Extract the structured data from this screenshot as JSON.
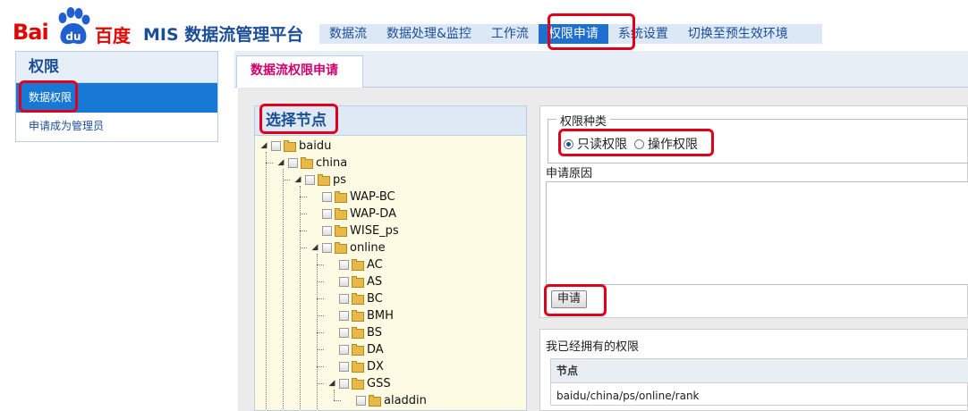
{
  "header": {
    "logo_left": "Bai",
    "logo_mid": "du",
    "logo_right": "百度",
    "app_title": "MIS 数据流管理平台",
    "nav": [
      "数据流",
      "数据处理&监控",
      "工作流",
      "权限申请",
      "系统设置",
      "切换至预生效环境"
    ],
    "active_nav": "权限申请"
  },
  "sidebar": {
    "title": "权限",
    "items": [
      "数据权限",
      "申请成为管理员"
    ]
  },
  "main": {
    "tab": "数据流权限申请",
    "tree_title": "选择节点",
    "tree": [
      {
        "label": "baidu",
        "depth": 0,
        "expanded": true
      },
      {
        "label": "china",
        "depth": 1,
        "expanded": true
      },
      {
        "label": "ps",
        "depth": 2,
        "expanded": true
      },
      {
        "label": "WAP-BC",
        "depth": 3
      },
      {
        "label": "WAP-DA",
        "depth": 3
      },
      {
        "label": "WISE_ps",
        "depth": 3
      },
      {
        "label": "online",
        "depth": 3,
        "expanded": true
      },
      {
        "label": "AC",
        "depth": 4
      },
      {
        "label": "AS",
        "depth": 4
      },
      {
        "label": "BC",
        "depth": 4
      },
      {
        "label": "BMH",
        "depth": 4
      },
      {
        "label": "BS",
        "depth": 4
      },
      {
        "label": "DA",
        "depth": 4
      },
      {
        "label": "DX",
        "depth": 4
      },
      {
        "label": "GSS",
        "depth": 4,
        "expanded": true
      },
      {
        "label": "aladdin",
        "depth": 5
      }
    ],
    "permission_type_legend": "权限种类",
    "permission_options": [
      "只读权限",
      "操作权限"
    ],
    "selected_option": "只读权限",
    "reason_label": "申请原因",
    "reason_value": "",
    "submit_label": "申请",
    "owned_title": "我已经拥有的权限",
    "owned_table": {
      "header": "节点",
      "rows": [
        "baidu/china/ps/online/rank"
      ]
    }
  },
  "colors": {
    "brand_red": "#e10602",
    "nav_blue": "#1b4e98",
    "active_blue": "#1f6fd0",
    "highlight_red": "#e0001b"
  }
}
